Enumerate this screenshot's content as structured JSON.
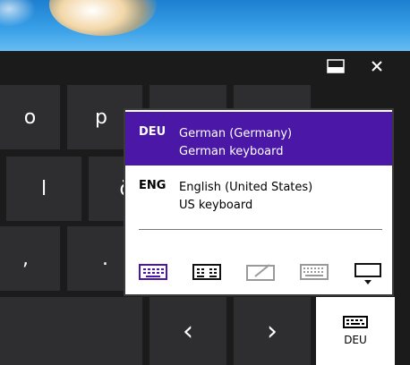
{
  "window": {
    "minimize_icon": "dock-icon",
    "close_icon": "close-icon"
  },
  "keys": [
    {
      "id": "o",
      "label": "o"
    },
    {
      "id": "p",
      "label": "p"
    },
    {
      "id": "l",
      "label": "l"
    },
    {
      "id": "partial",
      "label": "ö"
    },
    {
      "id": "comma",
      "label": ","
    },
    {
      "id": "period",
      "label": "."
    },
    {
      "id": "left",
      "label": "‹"
    },
    {
      "id": "right",
      "label": "›"
    }
  ],
  "language_popup": {
    "languages": [
      {
        "code": "DEU",
        "name": "German (Germany)",
        "layout": "German keyboard",
        "selected": true
      },
      {
        "code": "ENG",
        "name": "English (United States)",
        "layout": "US keyboard",
        "selected": false
      }
    ],
    "keyboard_modes": [
      {
        "name": "standard-keyboard-icon",
        "state": "selected"
      },
      {
        "name": "split-keyboard-icon",
        "state": "normal"
      },
      {
        "name": "handwriting-icon",
        "state": "disabled"
      },
      {
        "name": "full-keyboard-icon",
        "state": "disabled"
      },
      {
        "name": "hide-keyboard-icon",
        "state": "normal"
      }
    ],
    "accent_color": "#4a17a6"
  },
  "language_key": {
    "label": "DEU",
    "icon": "keyboard-icon"
  }
}
